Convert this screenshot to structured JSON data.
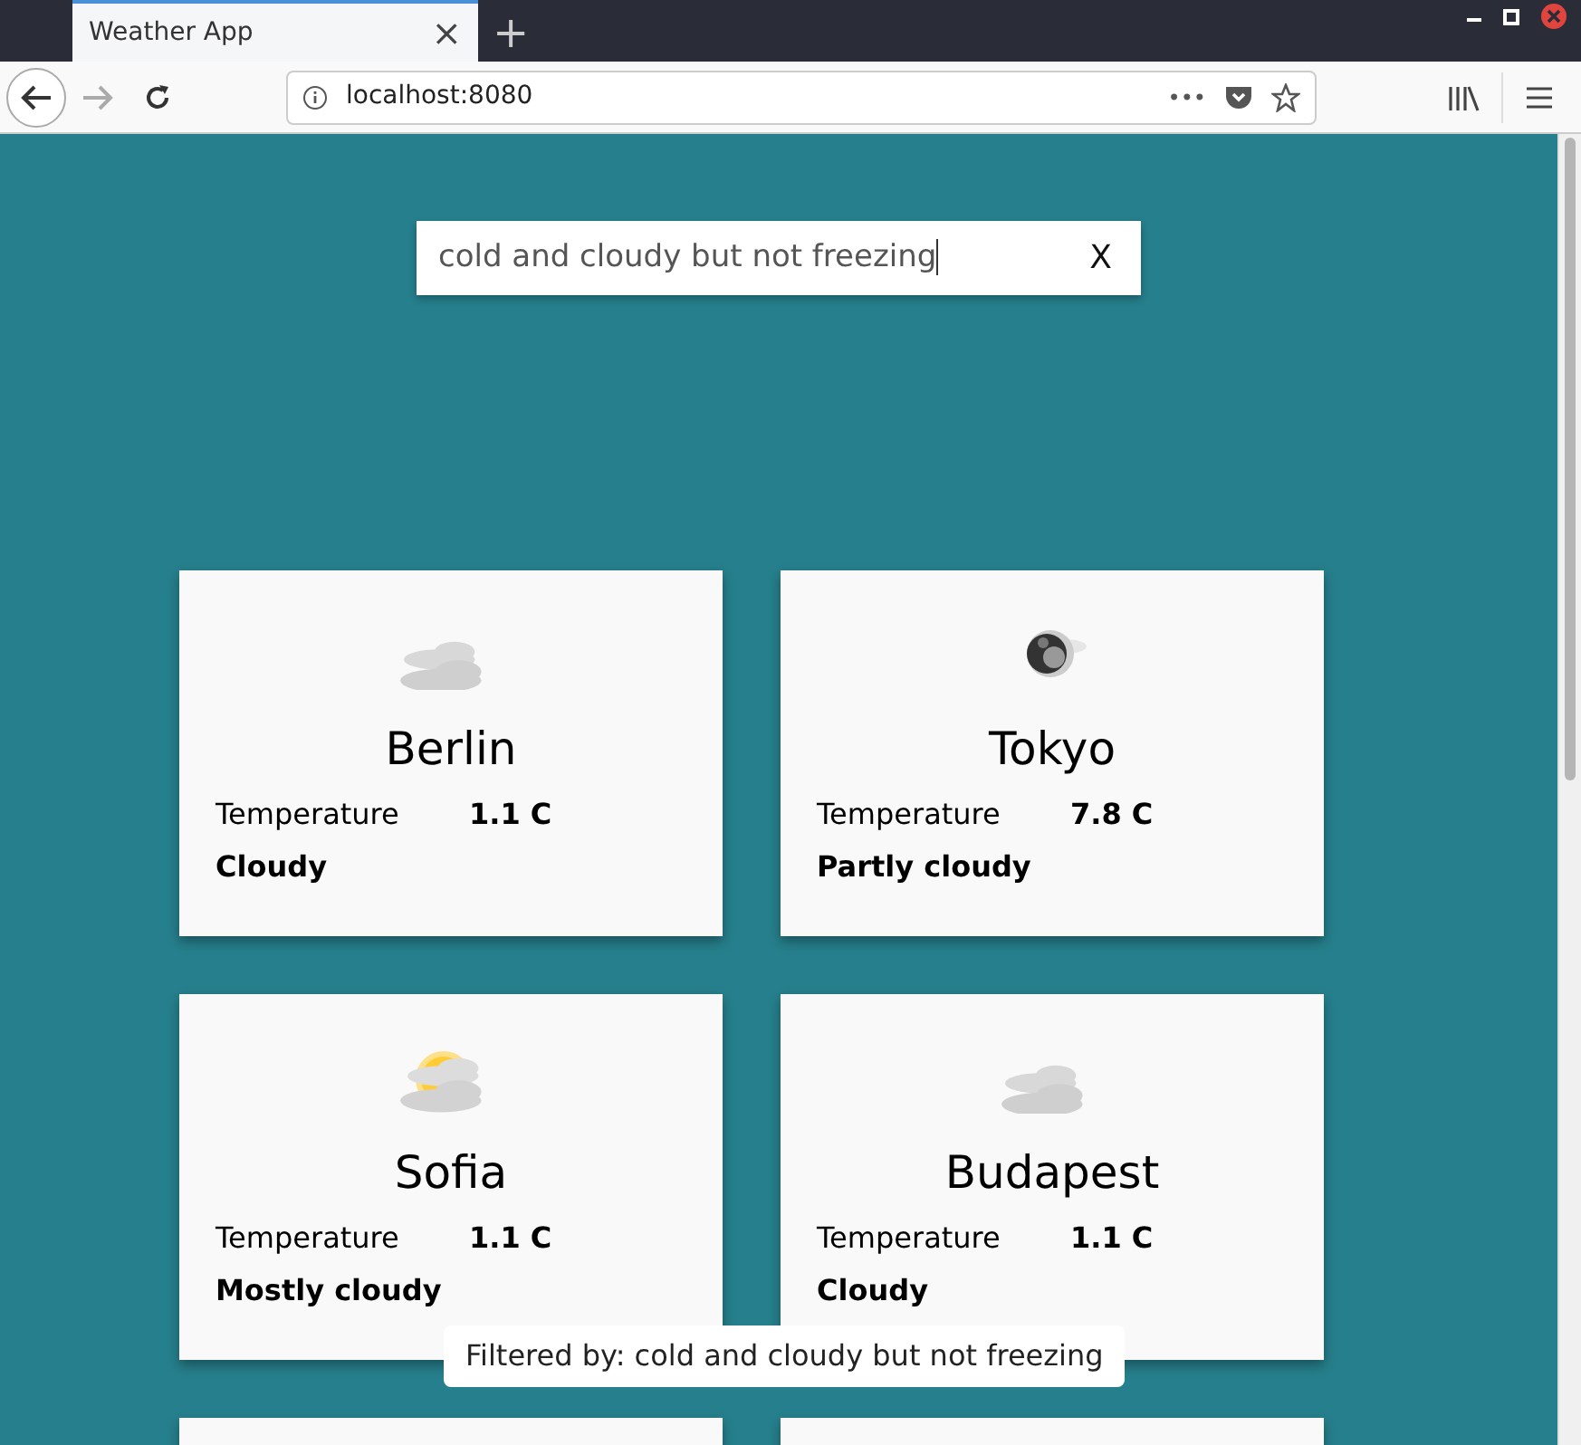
{
  "browser": {
    "tab_title": "Weather App",
    "tab_close": "×",
    "new_tab": "+",
    "address": "localhost:8080",
    "page_actions": "•••"
  },
  "search": {
    "value": "cold and cloudy but not freezing",
    "clear": "X"
  },
  "cards": [
    {
      "kind": "cloudy",
      "city": "Berlin",
      "temperature_label": "Temperature",
      "temperature": "1.1 C",
      "condition": "Cloudy"
    },
    {
      "kind": "moon",
      "city": "Tokyo",
      "temperature_label": "Temperature",
      "temperature": "7.8 C",
      "condition": "Partly cloudy"
    },
    {
      "kind": "sun_cloud",
      "city": "Sofia",
      "temperature_label": "Temperature",
      "temperature": "1.1 C",
      "condition": "Mostly cloudy"
    },
    {
      "kind": "cloudy",
      "city": "Budapest",
      "temperature_label": "Temperature",
      "temperature": "1.1 C",
      "condition": "Cloudy"
    },
    {
      "kind": "clipped"
    },
    {
      "kind": "clipped"
    }
  ],
  "toast": "Filtered by: cold and cloudy but not freezing"
}
